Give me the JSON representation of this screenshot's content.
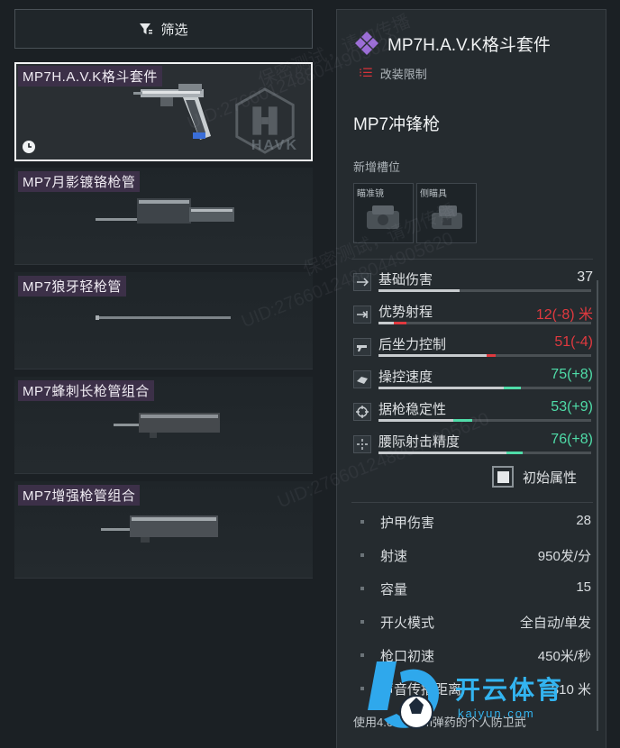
{
  "filter": {
    "label": "筛选"
  },
  "attachments": [
    {
      "label": "MP7H.A.V.K格斗套件",
      "selected": true,
      "brand": "HAVK"
    },
    {
      "label": "MP7月影镀铬枪管"
    },
    {
      "label": "MP7狼牙轻枪管"
    },
    {
      "label": "MP7蜂刺长枪管组合"
    },
    {
      "label": "MP7增强枪管组合"
    }
  ],
  "detail": {
    "title": "MP7H.A.V.K格斗套件",
    "mod_limit": "改装限制",
    "weapon_name": "MP7冲锋枪",
    "new_slots_label": "新增槽位",
    "slots": [
      {
        "name": "瞄准镜",
        "icon": "sight-icon"
      },
      {
        "name": "侧瞄具",
        "icon": "side-sight-icon"
      }
    ],
    "stats": [
      {
        "name": "基础伤害",
        "value": "37",
        "level": 0.38,
        "delta": 0,
        "color": "#dfe2e4",
        "icon": "damage-icon"
      },
      {
        "name": "优势射程",
        "value": "12(-8) 米",
        "level": 0.07,
        "delta": -0.06,
        "color": "#e0393f",
        "icon": "range-icon"
      },
      {
        "name": "后坐力控制",
        "value": "51(-4)",
        "level": 0.51,
        "delta": -0.04,
        "color": "#e0393f",
        "icon": "recoil-icon"
      },
      {
        "name": "操控速度",
        "value": "75(+8)",
        "level": 0.67,
        "delta": 0.08,
        "color": "#4fdca8",
        "icon": "handling-icon"
      },
      {
        "name": "据枪稳定性",
        "value": "53(+9)",
        "level": 0.44,
        "delta": 0.09,
        "color": "#4fdca8",
        "icon": "stability-icon"
      },
      {
        "name": "腰际射击精度",
        "value": "76(+8)",
        "level": 0.68,
        "delta": 0.08,
        "color": "#4fdca8",
        "icon": "hipfire-icon"
      }
    ],
    "reset_label": "初始属性",
    "attributes": [
      {
        "name": "护甲伤害",
        "value": "28"
      },
      {
        "name": "射速",
        "value": "950发/分"
      },
      {
        "name": "容量",
        "value": "15"
      },
      {
        "name": "开火模式",
        "value": "全自动/单发"
      },
      {
        "name": "枪口初速",
        "value": "450米/秒"
      },
      {
        "name": "声音传播距离",
        "value": "310 米"
      }
    ],
    "description": "使用4.6×30mm弹药的个人防卫武"
  },
  "watermark": {
    "uid": "UID:2766012488044905620",
    "text": "保密测试，请勿传播"
  },
  "logo": {
    "cn": "开云体育",
    "en": "kaiyun.com"
  },
  "colors": {
    "accent_purple": "#9b6cd6",
    "red": "#e0393f",
    "green": "#4fdca8"
  }
}
